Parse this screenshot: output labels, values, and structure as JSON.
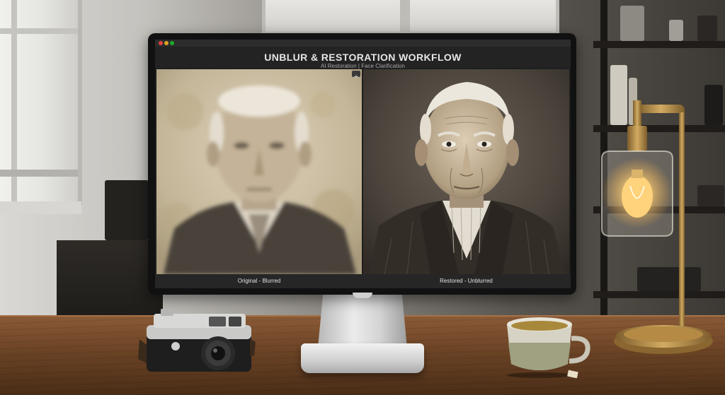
{
  "app": {
    "title": "UNBLUR & RESTORATION WORKFLOW",
    "subtitle": "AI Restoration | Face Clarification"
  },
  "panels": {
    "left": {
      "caption": "Original - Blurred"
    },
    "right": {
      "caption": "Restored - Unblurred"
    }
  },
  "icons": {
    "window_controls": [
      "close-dot",
      "minimize-dot",
      "maximize-dot"
    ],
    "panel_toolbar": "expand-icon"
  },
  "colors": {
    "screen_bg": "#1e1e1e",
    "sepia_light": "#d8cbb2",
    "sepia_dark": "#3e3832",
    "lamp_brass": "#b48a45",
    "bulb_glow": "#ffcf73"
  }
}
